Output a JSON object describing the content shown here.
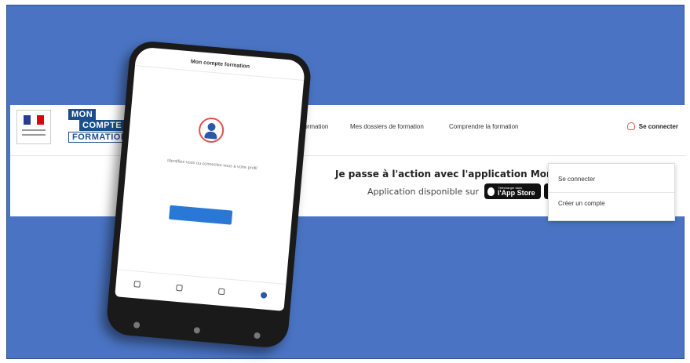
{
  "site": {
    "logo": {
      "line1": "MON",
      "line2": "COMPTE",
      "line3": "FORMATION"
    },
    "nav": [
      {
        "label": "formation"
      },
      {
        "label": "Mes dossiers de formation"
      },
      {
        "label": "Comprendre la formation"
      }
    ],
    "login_label": "Se connecter",
    "banner_title": "Je passe à l'action avec l'application Mon compte fo",
    "banner_subtitle": "Application disponible sur",
    "appstore": {
      "small": "Télécharger dans",
      "big": "l'App Store"
    },
    "dropdown": {
      "options": [
        "Se connecter",
        "Créer un compte"
      ]
    },
    "colors": {
      "background": "#4a74c3",
      "brand_blue": "#1c4f8a",
      "accent_red": "#e0524b"
    }
  },
  "phone": {
    "app_title": "Mon compte formation",
    "text": "Identifiez-vous ou connectez-vous à votre profil",
    "cta": "",
    "account_prompt": "",
    "account_link": "",
    "tabs": [
      {
        "label": ""
      },
      {
        "label": ""
      },
      {
        "label": ""
      },
      {
        "label": ""
      }
    ]
  }
}
